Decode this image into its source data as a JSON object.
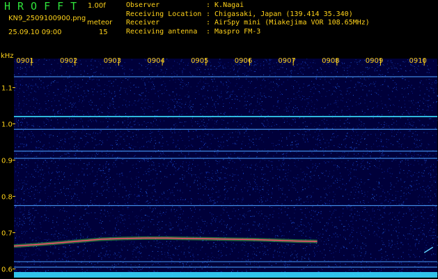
{
  "header": {
    "app_title": "HROFFT",
    "version": "1.00f",
    "filename": "KN9_2509100900.png",
    "meteor_label": "meteor",
    "datetime": "25.09.10 09:00",
    "count": "15",
    "info": [
      {
        "key": "Observer",
        "value": ": K.Nagai"
      },
      {
        "key": "Receiving Location",
        "value": ": Chigasaki, Japan (139.414 35.340)"
      },
      {
        "key": "Receiver",
        "value": ": AirSpy mini (Miakejima VOR 108.65MHz)"
      },
      {
        "key": "Receiving antenna",
        "value": ": Maspro FM-3"
      }
    ]
  },
  "colors": {
    "label": "#ffd21a",
    "title": "#2fe33a",
    "background": "#00003a",
    "tone": "#4aa0ff",
    "echo": "#ff4b6e",
    "baseline": "#35d8ff"
  },
  "chart_data": {
    "type": "heatmap",
    "ylabel": "kHz",
    "yticks": [
      "0.6",
      "0.7",
      "0.8",
      "0.9",
      "1.0",
      "1.1"
    ],
    "ytick_values": [
      0.6,
      0.7,
      0.8,
      0.9,
      1.0,
      1.1
    ],
    "xticks": [
      "0901",
      "0902",
      "0903",
      "0904",
      "0905",
      "0906",
      "0907",
      "0908",
      "0909",
      "0910"
    ],
    "xtick_values": [
      1,
      2,
      3,
      4,
      5,
      6,
      7,
      8,
      9,
      10
    ],
    "ylim": [
      0.58,
      1.18
    ],
    "xlim": [
      0.6,
      10.3
    ],
    "horizontal_tones_khz": [
      1.13,
      1.02,
      0.985,
      0.925,
      0.905,
      0.775,
      0.62,
      0.605
    ],
    "strong_tone_khz": 1.02,
    "echo": {
      "x_minutes": [
        0.0,
        0.5,
        1.0,
        1.5,
        2.0,
        2.5,
        3.0,
        3.5,
        4.0,
        4.5,
        5.0,
        5.5,
        6.0,
        6.5,
        6.95
      ],
      "y_khz": [
        0.663,
        0.667,
        0.672,
        0.677,
        0.682,
        0.684,
        0.685,
        0.685,
        0.684,
        0.683,
        0.682,
        0.681,
        0.679,
        0.677,
        0.676
      ]
    },
    "late_trace": {
      "x_minutes": [
        10.0,
        10.2
      ],
      "y_khz": [
        0.645,
        0.66
      ]
    }
  }
}
